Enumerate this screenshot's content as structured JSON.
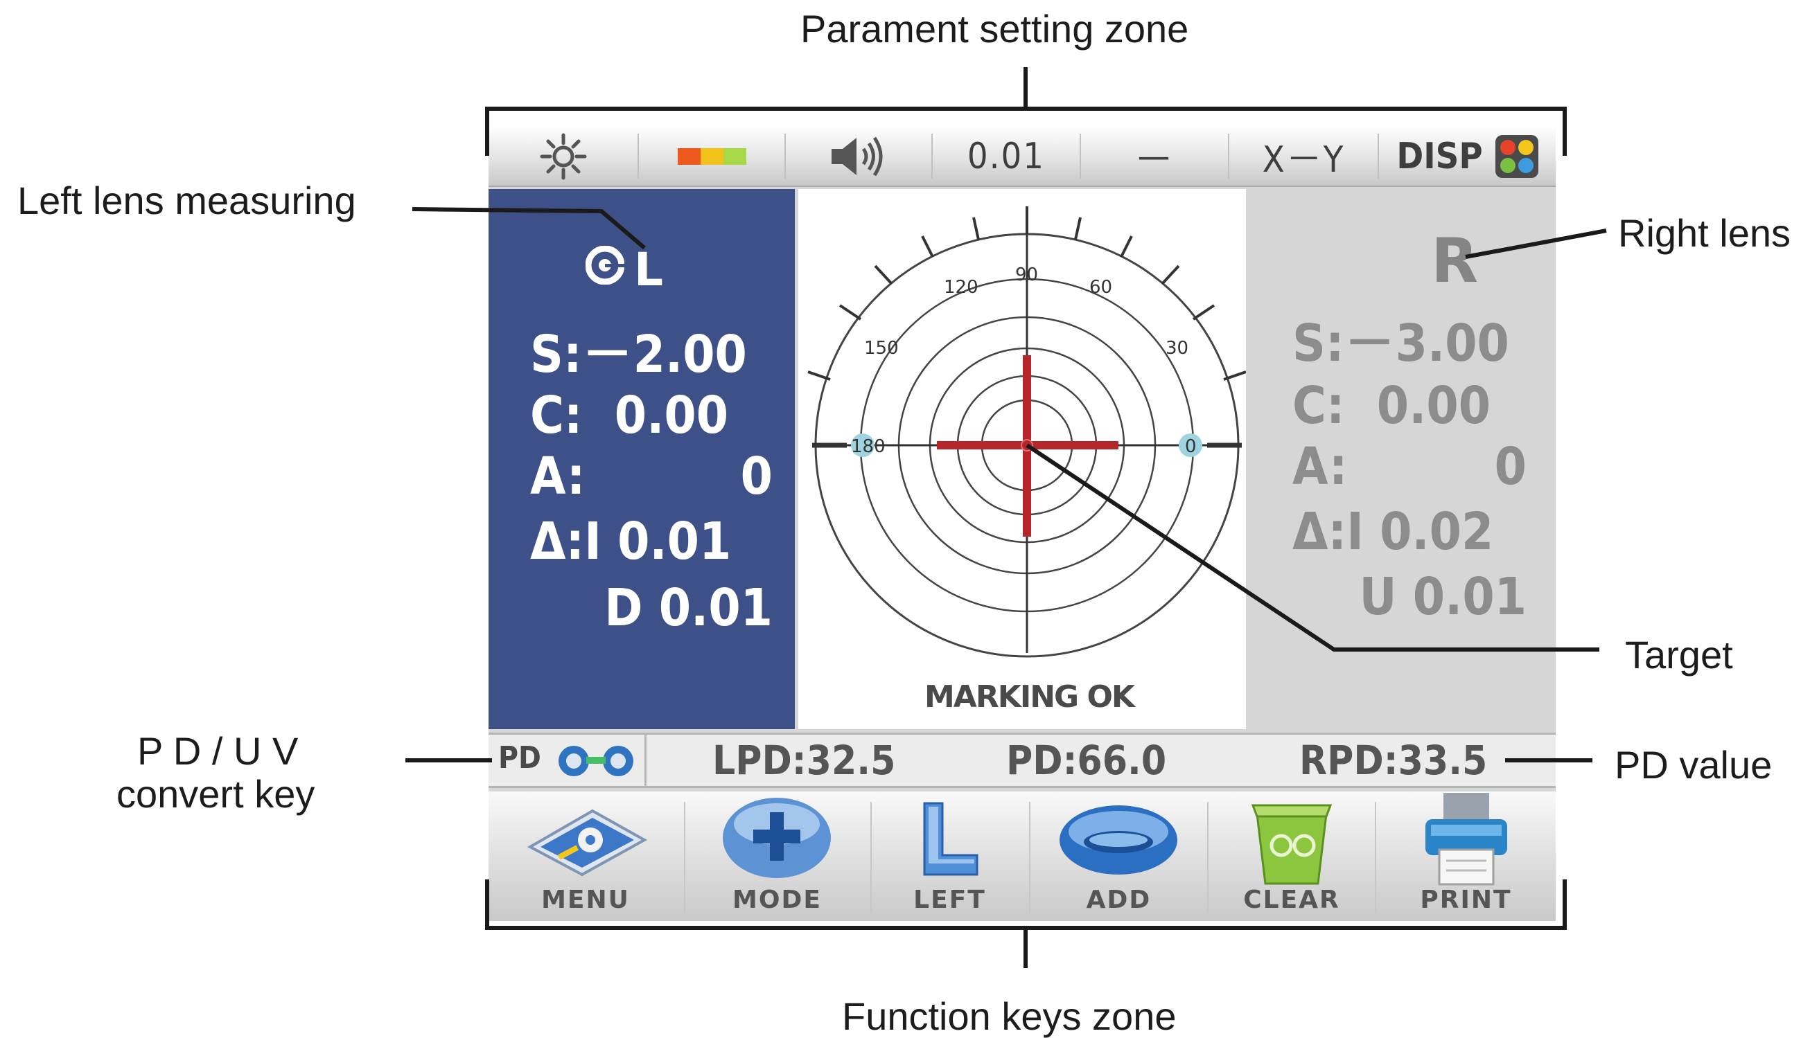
{
  "callouts": {
    "top": "Parament setting zone",
    "left_lens": "Left lens measuring",
    "right_lens": "Right lens",
    "target": "Target",
    "pd_uv_line1": "P D / U V",
    "pd_uv_line2": "convert key",
    "pd_value": "PD value",
    "bottom": "Function keys zone"
  },
  "param_bar": {
    "items": [
      {
        "name": "brightness",
        "icon": "sun-icon"
      },
      {
        "name": "battery",
        "icon": "color-bar-icon",
        "colors": [
          "#ee5a1e",
          "#f0c21a",
          "#a6d84a"
        ]
      },
      {
        "name": "sound",
        "icon": "speaker-icon"
      },
      {
        "name": "step",
        "text": "0.01"
      },
      {
        "name": "cyl",
        "text": "—"
      },
      {
        "name": "mode",
        "text": "X－Y"
      },
      {
        "name": "disp",
        "text": "DISP",
        "icon": "grid-icon",
        "colors": [
          "#e8432a",
          "#f4c71d",
          "#7ac043",
          "#3d9be0"
        ]
      }
    ]
  },
  "left_lens": {
    "label": "L",
    "icon": "lens-indicator-icon",
    "s": "S:－2.00",
    "c": "C:  0.00",
    "a_label": "A:",
    "a_value": "0",
    "prism1": "Δ:I 0.01",
    "prism2": "D 0.01",
    "bg_color": "#3d5088"
  },
  "right_lens": {
    "label": "R",
    "s": "S:－3.00",
    "c": "C:  0.00",
    "a_label": "A:",
    "a_value": "0",
    "prism1": "Δ:I 0.02",
    "prism2": "U 0.01"
  },
  "target": {
    "angles": [
      "120",
      "90",
      "60",
      "150",
      "30",
      "180",
      "0"
    ],
    "status": "MARKING OK",
    "cross_color": "#b5262b"
  },
  "pd_bar": {
    "key_label": "PD",
    "lpd": "LPD:32.5",
    "pd": "PD:66.0",
    "rpd": "RPD:33.5"
  },
  "function_keys": [
    {
      "label": "MENU",
      "icon": "menu-tablet-icon"
    },
    {
      "label": "MODE",
      "icon": "plus-button-icon"
    },
    {
      "label": "LEFT",
      "icon": "l-letter-icon"
    },
    {
      "label": "ADD",
      "icon": "add-lens-icon"
    },
    {
      "label": "CLEAR",
      "icon": "recycle-bin-icon"
    },
    {
      "label": "PRINT",
      "icon": "printer-icon"
    }
  ]
}
